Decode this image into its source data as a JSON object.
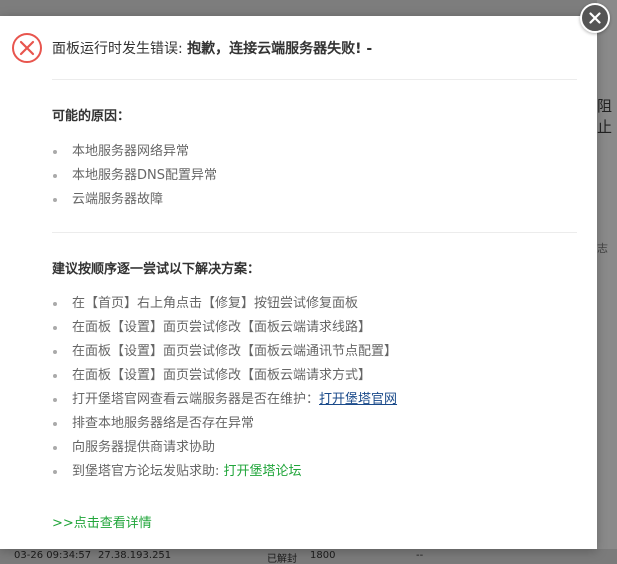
{
  "background": {
    "right_text": "阻止",
    "right_text2": "志",
    "footer": {
      "time": "03-26 09:34:57",
      "ip": "27.38.193.251",
      "status": "已解封",
      "value": "1800",
      "dash": "--"
    }
  },
  "modal": {
    "header_prefix": "面板运行时发生错误: ",
    "header_message": "抱歉，连接云端服务器失败! -",
    "reasons_title": "可能的原因：",
    "reasons": [
      "本地服务器网络异常",
      "本地服务器DNS配置异常",
      "云端服务器故障"
    ],
    "solutions_title": "建议按顺序逐一尝试以下解决方案：",
    "solutions": [
      "在【首页】右上角点击【修复】按钮尝试修复面板",
      "在面板【设置】面页尝试修改【面板云端请求线路】",
      "在面板【设置】面页尝试修改【面板云端通讯节点配置】",
      "在面板【设置】面页尝试修改【面板云端请求方式】",
      "打开堡塔官网查看云端服务器是否在维护：",
      "排查本地服务器络是否存在异常",
      "向服务器提供商请求协助",
      "到堡塔官方论坛发贴求助: "
    ],
    "official_site_link": "打开堡塔官网",
    "forum_link": "打开堡塔论坛",
    "details_link": ">>点击查看详情"
  },
  "colors": {
    "error_red": "#e8554e",
    "link_green": "#20a53a",
    "link_blue": "#1a4a8a"
  },
  "icons": {
    "error": "error-x-circle-icon",
    "close": "close-icon"
  }
}
